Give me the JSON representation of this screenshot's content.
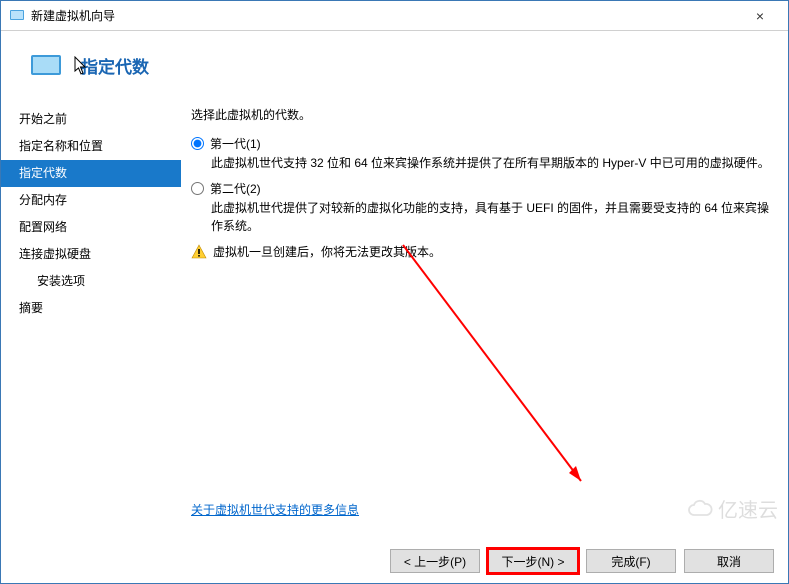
{
  "window": {
    "title": "新建虚拟机向导",
    "close": "×"
  },
  "header": {
    "title": "指定代数"
  },
  "sidebar": {
    "items": [
      {
        "label": "开始之前"
      },
      {
        "label": "指定名称和位置"
      },
      {
        "label": "指定代数"
      },
      {
        "label": "分配内存"
      },
      {
        "label": "配置网络"
      },
      {
        "label": "连接虚拟硬盘"
      },
      {
        "label": "安装选项"
      },
      {
        "label": "摘要"
      }
    ],
    "selected_index": 2,
    "sub_index": 6
  },
  "content": {
    "intro": "选择此虚拟机的代数。",
    "gen1": {
      "label": "第一代(1)",
      "desc": "此虚拟机世代支持 32 位和 64 位来宾操作系统并提供了在所有早期版本的 Hyper-V 中已可用的虚拟硬件。"
    },
    "gen2": {
      "label": "第二代(2)",
      "desc": "此虚拟机世代提供了对较新的虚拟化功能的支持，具有基于 UEFI 的固件，并且需要受支持的 64 位来宾操作系统。"
    },
    "warning": "虚拟机一旦创建后，你将无法更改其版本。",
    "link": "关于虚拟机世代支持的更多信息"
  },
  "footer": {
    "prev": "< 上一步(P)",
    "next": "下一步(N) >",
    "finish": "完成(F)",
    "cancel": "取消"
  },
  "watermark": "亿速云"
}
